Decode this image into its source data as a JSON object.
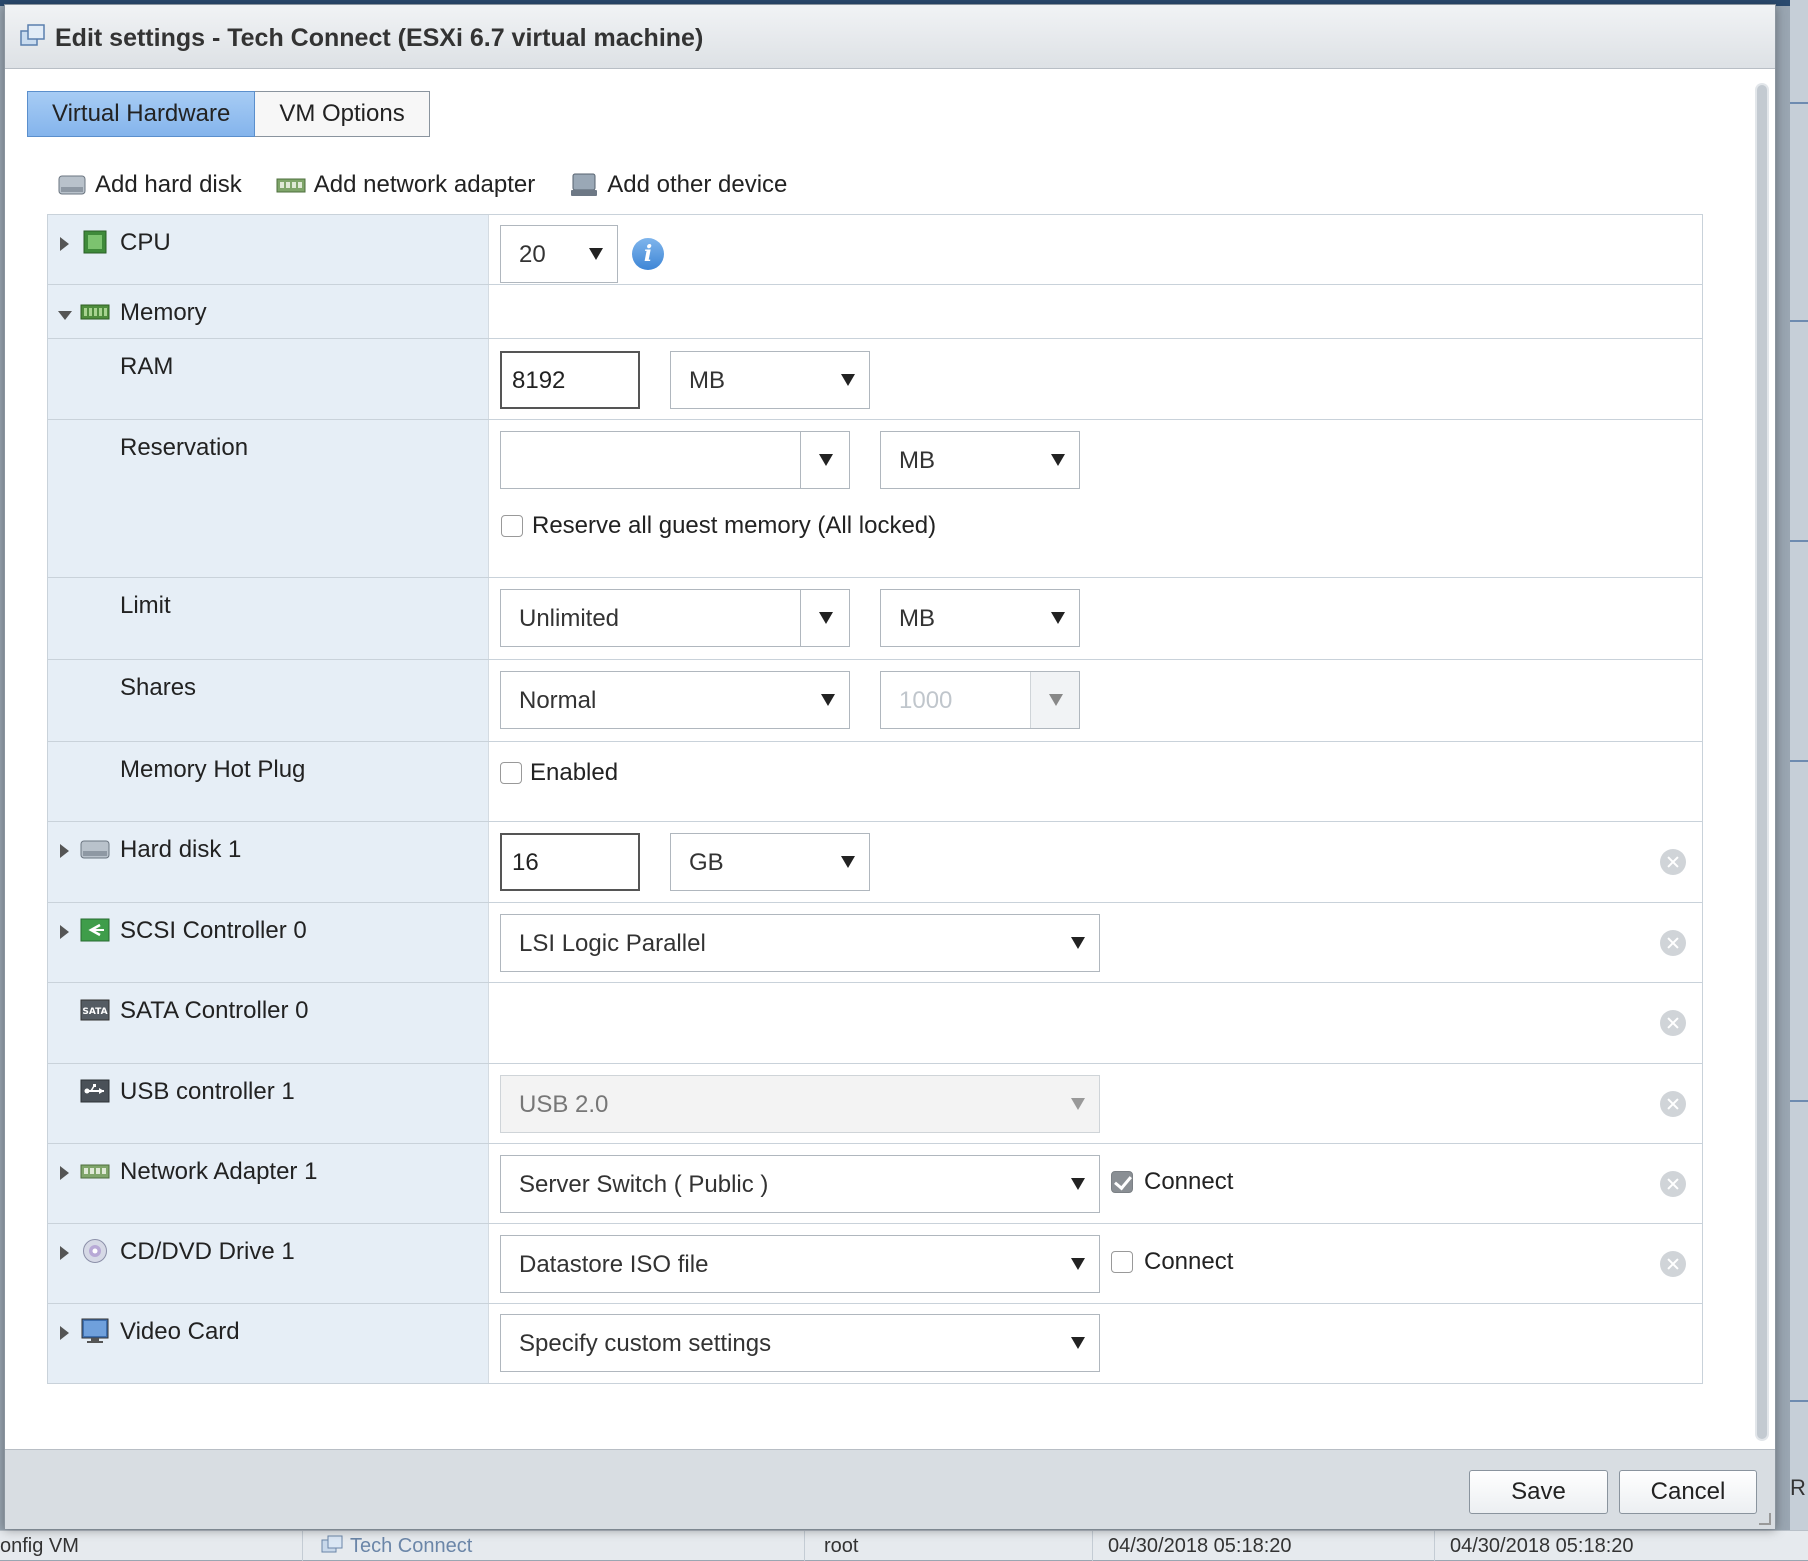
{
  "dialog": {
    "title": "Edit settings - Tech Connect (ESXi 6.7 virtual machine)",
    "tabs": [
      {
        "label": "Virtual Hardware",
        "active": true
      },
      {
        "label": "VM Options",
        "active": false
      }
    ],
    "toolbar": {
      "add_hard_disk": "Add hard disk",
      "add_network_adapter": "Add network adapter",
      "add_other_device": "Add other device"
    },
    "hardware": {
      "cpu": {
        "label": "CPU",
        "value": "20"
      },
      "memory": {
        "label": "Memory",
        "ram": {
          "label": "RAM",
          "value": "8192",
          "unit": "MB"
        },
        "reservation": {
          "label": "Reservation",
          "value": "",
          "unit": "MB",
          "reserve_all_label": "Reserve all guest memory (All locked)",
          "reserve_all_checked": false
        },
        "limit": {
          "label": "Limit",
          "value": "Unlimited",
          "unit": "MB"
        },
        "shares": {
          "label": "Shares",
          "value": "Normal",
          "amount": "1000"
        },
        "hot_plug": {
          "label": "Memory Hot Plug",
          "option_label": "Enabled",
          "checked": false
        }
      },
      "hard_disk": {
        "label": "Hard disk 1",
        "value": "16",
        "unit": "GB"
      },
      "scsi": {
        "label": "SCSI Controller 0",
        "value": "LSI Logic Parallel"
      },
      "sata": {
        "label": "SATA Controller 0"
      },
      "usb": {
        "label": "USB controller 1",
        "value": "USB 2.0"
      },
      "network": {
        "label": "Network Adapter 1",
        "value": "Server Switch ( Public )",
        "connect_label": "Connect",
        "connect_checked": true
      },
      "cddvd": {
        "label": "CD/DVD Drive 1",
        "value": "Datastore ISO file",
        "connect_label": "Connect",
        "connect_checked": false
      },
      "video": {
        "label": "Video Card",
        "value": "Specify custom settings"
      }
    },
    "buttons": {
      "save": "Save",
      "cancel": "Cancel"
    }
  },
  "background": {
    "task": "onfig VM",
    "vm_name": "Tech Connect",
    "user": "root",
    "queued": "04/30/2018 05:18:20",
    "started": "04/30/2018 05:18:20",
    "edge_letter": "R"
  },
  "colors": {
    "tab_active": "#84b4ec",
    "label_column": "#e6eef6",
    "info_icon": "#3e86d6"
  }
}
